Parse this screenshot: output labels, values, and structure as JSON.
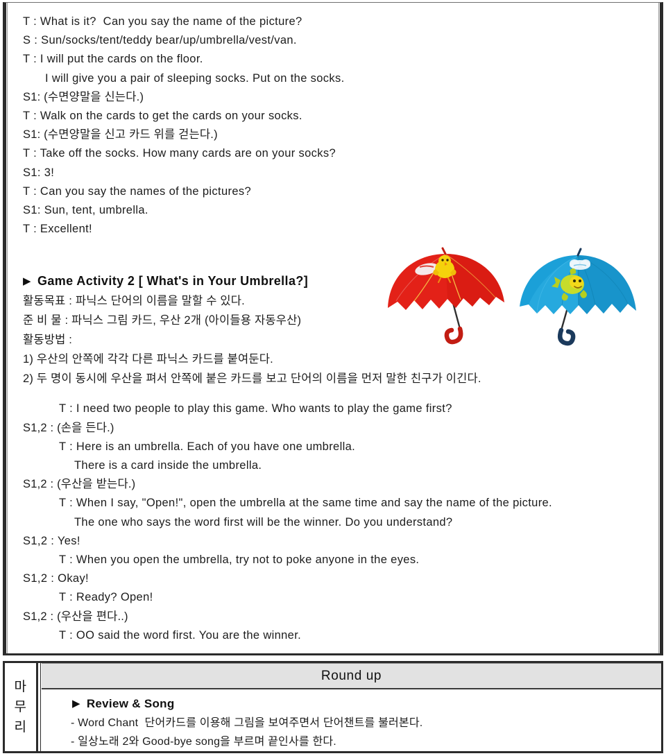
{
  "document": {
    "top_dialogue": [
      {
        "indent": 0,
        "text": "T : What is it?  Can you say the name of the picture?"
      },
      {
        "indent": 0,
        "text": "S : Sun/socks/tent/teddy bear/up/umbrella/vest/van."
      },
      {
        "indent": 0,
        "text": "T : I will put the cards on the floor."
      },
      {
        "indent": 2,
        "text": "I will give you a pair of sleeping socks. Put on the socks."
      },
      {
        "indent": 0,
        "text": "S1: (수면양말을 신는다.)"
      },
      {
        "indent": 0,
        "text": "T : Walk on the cards to get the cards on your socks."
      },
      {
        "indent": 0,
        "text": "S1: (수면양말을 신고 카드 위를 걷는다.)"
      },
      {
        "indent": 0,
        "text": "T : Take off the socks. How many cards are on your socks?"
      },
      {
        "indent": 0,
        "text": "S1: 3!"
      },
      {
        "indent": 0,
        "text": "T : Can you say the names of the pictures?"
      },
      {
        "indent": 0,
        "text": "S1: Sun, tent, umbrella."
      },
      {
        "indent": 0,
        "text": "T : Excellent!"
      }
    ],
    "activity": {
      "bullet": "▶",
      "title": "Game Activity 2 [ What's in Your Umbrella?]",
      "meta_lines": [
        "활동목표 : 파닉스 단어의 이름을 말할 수 있다.",
        "준 비 물 : 파닉스 그림 카드, 우산 2개 (아이들용 자동우산)",
        "활동방법 :",
        "1) 우산의 안쪽에 각각 다른 파닉스 카드를 붙여둔다.",
        "2) 두 명이 동시에 우산을 펴서 안쪽에 붙은 카드를 보고 단어의 이름을 먼저 말한 친구가 이긴다."
      ]
    },
    "illustration": {
      "left_umbrella": {
        "name": "red-umbrella",
        "canopy_color": "#e32118",
        "handle_color": "#c41a12",
        "motif_color": "#f5d20c"
      },
      "right_umbrella": {
        "name": "blue-umbrella",
        "canopy_color": "#1ba0d8",
        "handle_color": "#1b3a5c",
        "motif_color": "#c6dc2b"
      }
    },
    "game_dialogue": [
      {
        "indent": 1,
        "text": "T : I need two people to play this game. Who wants to play the game first?"
      },
      {
        "indent": 0,
        "text": "S1,2 : (손을 든다.)"
      },
      {
        "indent": 1,
        "text": "T : Here is an umbrella. Each of you have one umbrella."
      },
      {
        "indent": 2,
        "text": "There is a card inside the umbrella."
      },
      {
        "indent": 0,
        "text": "S1,2 : (우산을 받는다.)"
      },
      {
        "indent": 1,
        "text": "T : When I say, \"Open!\", open the umbrella at the same time and say the name of the picture."
      },
      {
        "indent": 2,
        "text": "The one who says the word first will be the winner. Do you understand?"
      },
      {
        "indent": 0,
        "text": "S1,2 : Yes!"
      },
      {
        "indent": 1,
        "text": "T : When you open the umbrella, try not to poke anyone in the eyes."
      },
      {
        "indent": 0,
        "text": "S1,2 : Okay!"
      },
      {
        "indent": 1,
        "text": "T : Ready? Open!"
      },
      {
        "indent": 0,
        "text": "S1,2 : (우산을 편다..)"
      },
      {
        "indent": 1,
        "text": "T : OO said the word first. You are the winner."
      }
    ],
    "roundup": {
      "stage_label_chars": [
        "마",
        "무",
        "리"
      ],
      "header_title": "Round up",
      "bullet": "▶",
      "subtitle": "Review & Song",
      "items": [
        "- Word Chant  단어카드를 이용해 그림을 보여주면서 단어챈트를 불러본다.",
        "- 일상노래 2와 Good-bye song을 부르며 끝인사를 한다."
      ]
    }
  }
}
